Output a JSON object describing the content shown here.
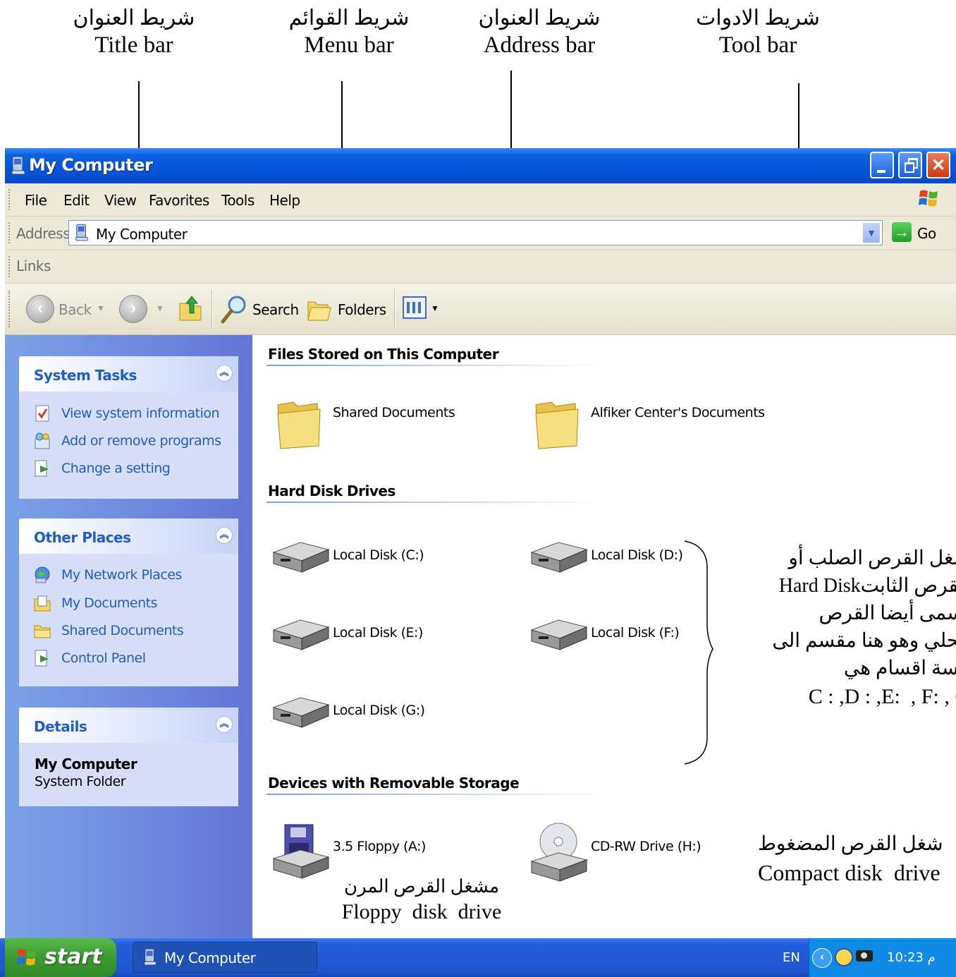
{
  "annotations": [
    {
      "arabic": "شريط العنوان",
      "english": "Title bar"
    },
    {
      "arabic": "شريط القوائم",
      "english": "Menu  bar"
    },
    {
      "arabic": "شريط العنوان",
      "english": "Address  bar"
    },
    {
      "arabic": "شريط الادوات",
      "english": "Tool  bar"
    }
  ],
  "window": {
    "title": "My Computer"
  },
  "menu": [
    "File",
    "Edit",
    "View",
    "Favorites",
    "Tools",
    "Help"
  ],
  "address": {
    "label": "Address",
    "value": "My Computer",
    "go": "Go"
  },
  "links": {
    "label": "Links"
  },
  "toolbar": {
    "back": "Back",
    "search": "Search",
    "folders": "Folders"
  },
  "sidebar": {
    "system_tasks": {
      "title": "System Tasks",
      "items": [
        "View system information",
        "Add or remove programs",
        "Change a setting"
      ]
    },
    "other_places": {
      "title": "Other Places",
      "items": [
        "My Network Places",
        "My Documents",
        "Shared Documents",
        "Control Panel"
      ]
    },
    "details": {
      "title": "Details",
      "name": "My Computer",
      "type": "System Folder"
    }
  },
  "content": {
    "files_section": "Files Stored on This Computer",
    "folders": [
      "Shared Documents",
      "Alfiker Center's Documents"
    ],
    "hdd_section": "Hard Disk Drives",
    "disks": [
      "Local Disk (C:)",
      "Local Disk (D:)",
      "Local Disk (E:)",
      "Local Disk (F:)",
      "Local Disk (G:)"
    ],
    "removable_section": "Devices with Removable Storage",
    "removable": [
      "3.5 Floppy (A:)",
      "CD-RW Drive (H:)"
    ]
  },
  "notes": {
    "hdd": [
      "شغل القرص الصلب أو",
      "القرص الثابتHard Disk",
      "يسمى أيضا القرص",
      "محلي وهو هنا مقسم الى",
      "مسة اقسام هي",
      "C : ,D : ,E:  , F: , G"
    ],
    "floppy": [
      "مشغل القرص المرن",
      "Floppy  disk  drive"
    ],
    "cd": [
      "شغل القرص المضغوط",
      "Compact disk  drive"
    ]
  },
  "taskbar": {
    "start": "start",
    "task": "My Computer",
    "lang": "EN",
    "time": "10:23 م"
  },
  "colors": {
    "title_blue": "#0553d8",
    "sidebar_blue": "#6375d6",
    "start_green": "#3c9a32"
  }
}
